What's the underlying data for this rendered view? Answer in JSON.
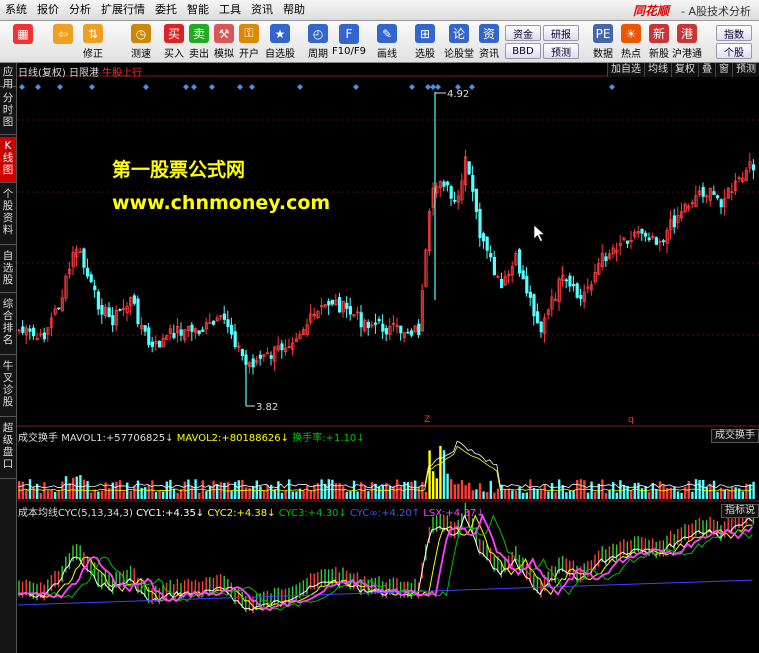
{
  "menu": [
    "系统",
    "报价",
    "分析",
    "扩展行情",
    "委托",
    "智能",
    "工具",
    "资讯",
    "帮助"
  ],
  "brand": "同花顺",
  "app_title": "- A股技术分析",
  "toolbar": [
    {
      "label": "",
      "icon": "grid-icon"
    },
    {
      "label": "",
      "icon": "back-arrow-icon"
    },
    {
      "label": "修正",
      "icon": "up-down-arrow-icon"
    },
    {
      "label": "测速",
      "icon": "clock-icon"
    },
    {
      "label": "买入",
      "icon": "buy-icon"
    },
    {
      "label": "卖出",
      "icon": "sell-icon"
    },
    {
      "label": "模拟",
      "icon": "hammer-icon"
    },
    {
      "label": "开户",
      "icon": "lock-icon"
    },
    {
      "label": "自选股",
      "icon": "star-icon"
    },
    {
      "label": "周期",
      "icon": "period-icon"
    },
    {
      "label": "F10/F9",
      "icon": "f10-icon"
    },
    {
      "label": "画线",
      "icon": "pen-icon"
    },
    {
      "label": "选股",
      "icon": "select-stock-icon"
    },
    {
      "label": "论股堂",
      "icon": "forum-icon"
    },
    {
      "label": "资讯",
      "icon": "news-icon"
    },
    {
      "label": "数据",
      "icon": "pe-icon"
    },
    {
      "label": "热点",
      "icon": "fire-icon"
    },
    {
      "label": "新股",
      "icon": "new-stock-icon"
    },
    {
      "label": "沪港通",
      "icon": "hk-connect-icon"
    }
  ],
  "toolbar_small": {
    "funds": "资金",
    "bbd": "BBD",
    "research": "研报",
    "forecast": "预测",
    "index": "指数",
    "stock": "个股"
  },
  "sidebar": [
    "应用",
    "分时图",
    "K线图",
    "个股资料",
    "自选股",
    "综合排名",
    "牛叉诊股",
    "超级盘口"
  ],
  "chart_header": {
    "main": "日线(复权)  日限港",
    "tag": "牛股上行"
  },
  "right_buttons": [
    "加自选",
    "均线",
    "复权",
    "叠",
    "窗",
    "预测"
  ],
  "watermark": {
    "line1": "第一股票公式网",
    "line2": "www.chnmoney.com"
  },
  "price_labels": {
    "high": "4.92",
    "low": "3.82",
    "marker_z": "Z",
    "marker_q": "q"
  },
  "volume_pane": {
    "title": "成交换手",
    "mavol1_label": "MAVOL1:",
    "mavol1": "+57706825↓",
    "mavol2_label": "MAVOL2:",
    "mavol2": "+80188626↓",
    "turnover_label": "换手率:",
    "turnover": "+1.10↓",
    "button": "成交换手"
  },
  "cyc_pane": {
    "title": "成本均线CYC(5,13,34,3)",
    "cyc1_label": "CYC1:",
    "cyc1": "+4.35↓",
    "cyc2_label": "CYC2:",
    "cyc2": "+4.38↓",
    "cyc3_label": "CYC3:",
    "cyc3": "+4.30↓",
    "cycinf_label": "CYC∞:",
    "cycinf": "+4.20↑",
    "lsx_label": "LSX:",
    "lsx": "+4.37↓",
    "button": "指标说"
  },
  "colors": {
    "up": "#ff3c3c",
    "down": "#54ffff",
    "cyc1": "#ffffff",
    "cyc2": "#ffff00",
    "cyc3": "#00c000",
    "cycinf": "#4040ff",
    "lsx": "#ff40ff"
  }
}
